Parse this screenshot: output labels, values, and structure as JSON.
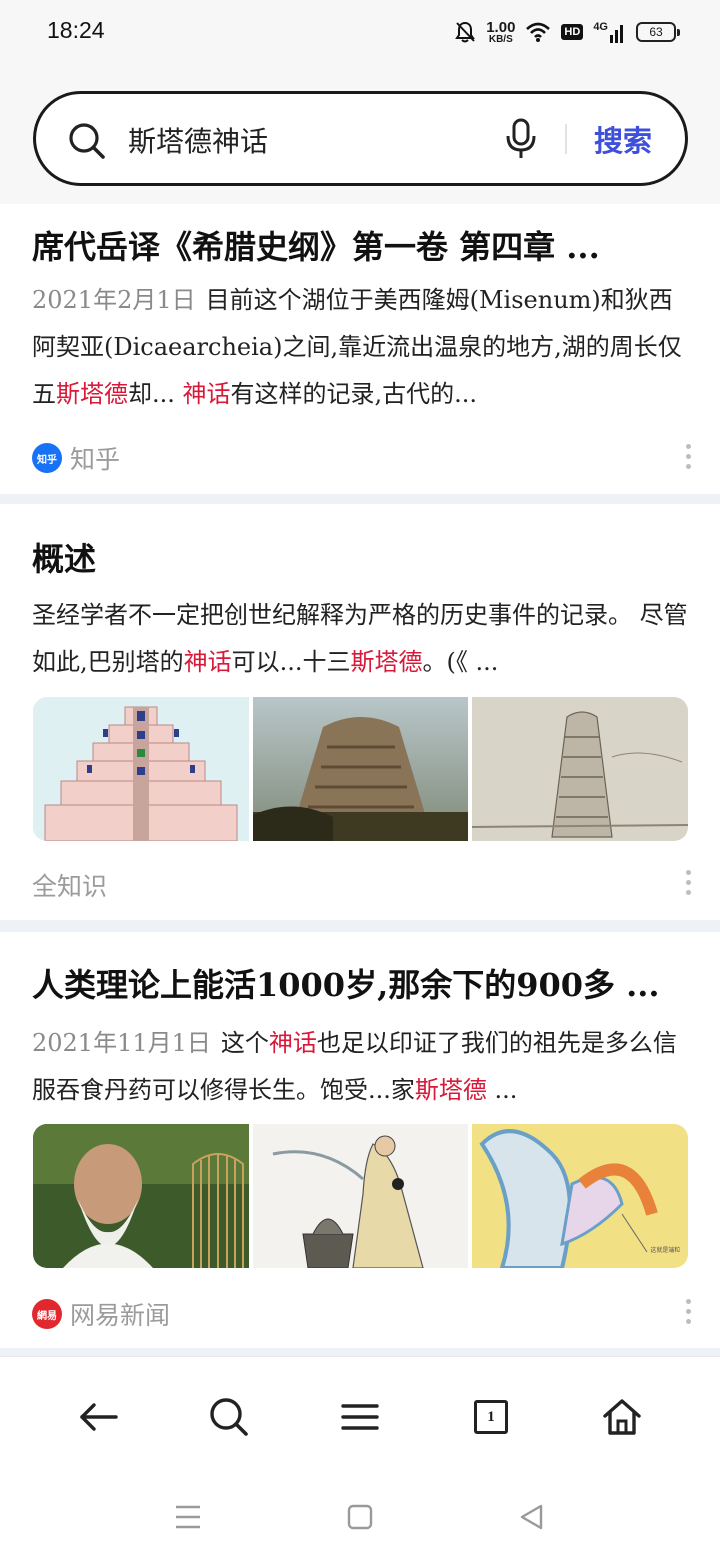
{
  "status_bar": {
    "time": "18:24",
    "net_speed_value": "1.00",
    "net_speed_unit": "KB/S",
    "hd": "HD",
    "network": "4G",
    "battery": "63",
    "icons": [
      "bell-off-icon",
      "wifi-icon",
      "hd-icon",
      "signal-icon",
      "battery-icon"
    ]
  },
  "search": {
    "query": "斯塔德神话",
    "submit_label": "搜索"
  },
  "results": [
    {
      "title": "席代岳译《希腊史纲》第一卷 第四章 ...",
      "date": "2021年2月1日",
      "body_parts": [
        "目前这个湖位于美西隆姆(Misenum)和狄西阿契亚(Dicaearcheia)之间,靠近流出温泉的地方,湖的周长仅五",
        "斯塔德",
        "却... ",
        "神话",
        "有这样的记录,古代的..."
      ],
      "source": "知乎",
      "source_logo_text": "知乎",
      "source_color": "#1772f6"
    },
    {
      "title": "概述",
      "body_parts": [
        "圣经学者不一定把创世纪解释为严格的历史事件的记录。 尽管如此,巴别塔的",
        "神话",
        "可以...十三",
        "斯塔德",
        "。(《 ..."
      ],
      "source": "全知识",
      "images": [
        "tower-of-babel-diagram",
        "tower-of-babel-painting",
        "tower-of-babel-engraving"
      ]
    },
    {
      "title": "人类理论上能活1000岁,那余下的900多 ...",
      "date": "2021年11月1日",
      "body_parts": [
        "这个",
        "神话",
        "也足以印证了我们的祖先是多么信服吞食丹药可以修得长生。饱受...家",
        "斯塔德",
        " ..."
      ],
      "source": "网易新闻",
      "source_logo_text": "網易",
      "source_color": "#e0282e",
      "images": [
        "old-man-photo",
        "alchemist-illustration",
        "cell-diagram"
      ],
      "image_caption": "这就是端粒"
    }
  ],
  "bottom_nav": {
    "tab_count": "1",
    "icons": [
      "back-icon",
      "search-icon",
      "menu-icon",
      "tabs-icon",
      "home-icon"
    ]
  },
  "colors": {
    "accent": "#3d4fdb",
    "highlight": "#d8193a"
  }
}
